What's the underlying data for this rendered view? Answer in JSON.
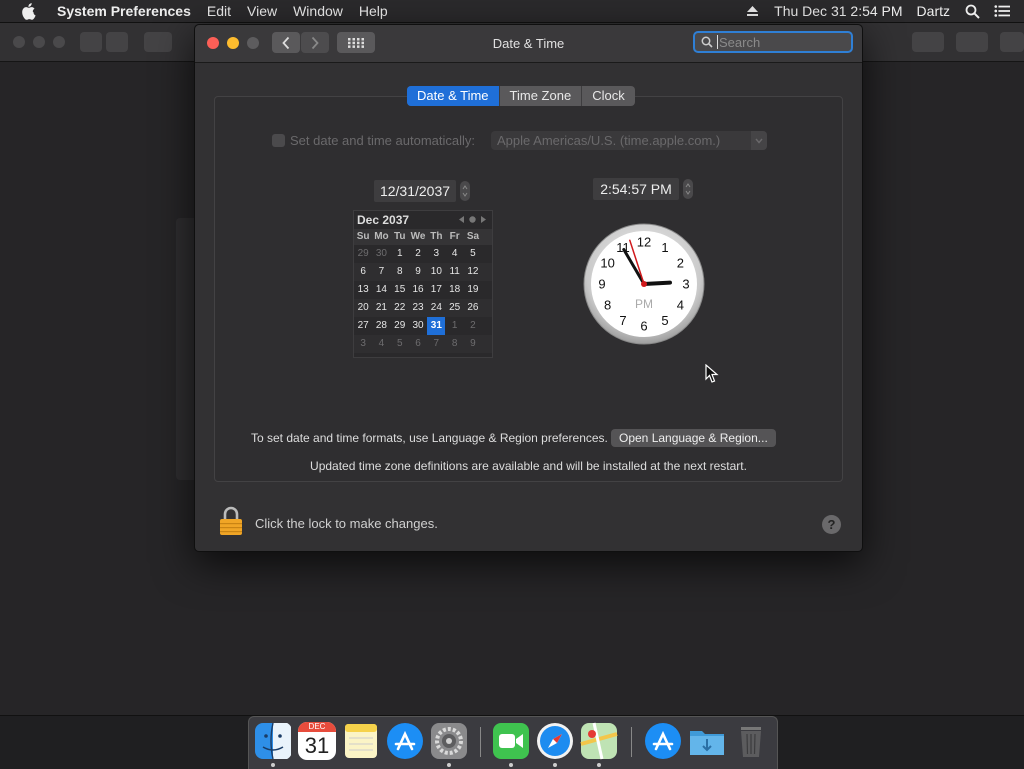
{
  "menubar": {
    "app_name": "System Preferences",
    "items": [
      "Edit",
      "View",
      "Window",
      "Help"
    ],
    "datetime": "Thu Dec 31  2:54 PM",
    "user": "Dartz"
  },
  "window": {
    "title": "Date & Time",
    "search_placeholder": "Search"
  },
  "tabs": [
    {
      "label": "Date & Time",
      "active": true
    },
    {
      "label": "Time Zone",
      "active": false
    },
    {
      "label": "Clock",
      "active": false
    }
  ],
  "auto_time": {
    "label": "Set date and time automatically:",
    "checked": false,
    "server": "Apple Americas/U.S. (time.apple.com.)"
  },
  "date_value": "12/31/2037",
  "time_value": "2:54:57 PM",
  "calendar": {
    "month_label": "Dec 2037",
    "weekdays": [
      "Su",
      "Mo",
      "Tu",
      "We",
      "Th",
      "Fr",
      "Sa"
    ],
    "weeks": [
      [
        "29",
        "30",
        "1",
        "2",
        "3",
        "4",
        "5"
      ],
      [
        "6",
        "7",
        "8",
        "9",
        "10",
        "11",
        "12"
      ],
      [
        "13",
        "14",
        "15",
        "16",
        "17",
        "18",
        "19"
      ],
      [
        "20",
        "21",
        "22",
        "23",
        "24",
        "25",
        "26"
      ],
      [
        "27",
        "28",
        "29",
        "30",
        "31",
        "1",
        "2"
      ],
      [
        "3",
        "4",
        "5",
        "6",
        "7",
        "8",
        "9"
      ]
    ],
    "selected_day": "31"
  },
  "clock": {
    "numbers": [
      "12",
      "1",
      "2",
      "3",
      "4",
      "5",
      "6",
      "7",
      "8",
      "9",
      "10",
      "11"
    ],
    "ampm": "PM",
    "hour": 2,
    "minute": 54,
    "second": 57
  },
  "formats_hint": "To set date and time formats, use Language & Region preferences.",
  "open_region_button": "Open Language & Region...",
  "timezone_notice": "Updated time zone definitions are available and will be installed at the next restart.",
  "lock_text": "Click the lock to make changes.",
  "help_label": "?",
  "dock": {
    "calendar_month": "DEC",
    "calendar_day": "31"
  }
}
